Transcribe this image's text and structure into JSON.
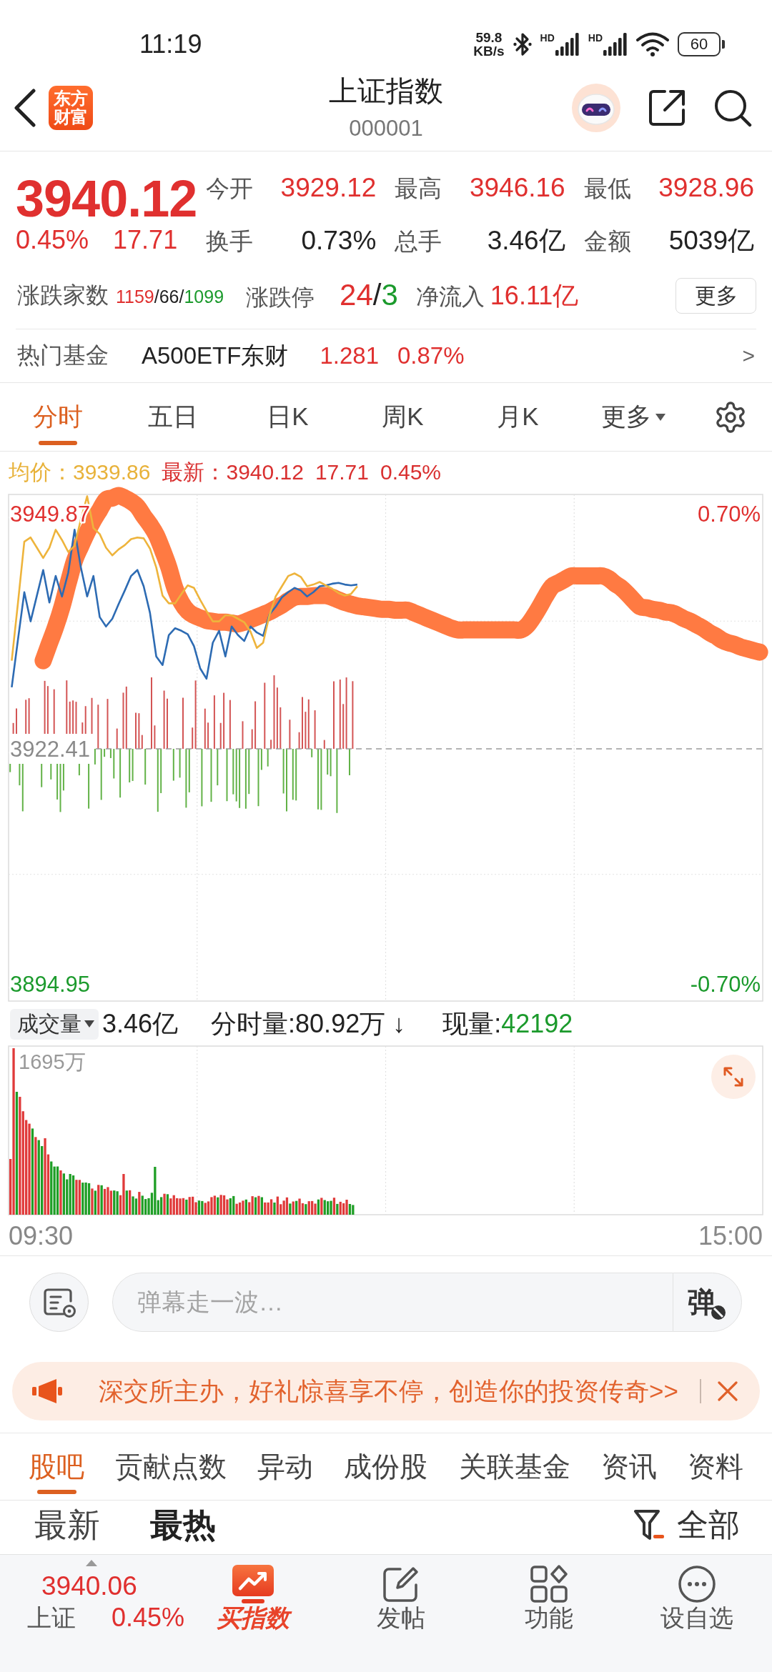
{
  "status_bar": {
    "time": "11:19",
    "net_speed": "59.8",
    "net_unit": "KB/s",
    "networks": [
      {
        "label": "HD"
      },
      {
        "label": "HD"
      }
    ],
    "battery": "60"
  },
  "header": {
    "logo": "东方财富",
    "title": "上证指数",
    "code": "000001"
  },
  "quote": {
    "price": "3940.12",
    "change_pct": "0.45%",
    "change": "17.71",
    "color": "#e0302f",
    "stats": [
      {
        "label": "今开",
        "value": "3929.12",
        "color": "#e0302f"
      },
      {
        "label": "最高",
        "value": "3946.16",
        "color": "#e0302f"
      },
      {
        "label": "最低",
        "value": "3928.96",
        "color": "#e0302f"
      },
      {
        "label": "换手",
        "value": "0.73%",
        "color": "#222222"
      },
      {
        "label": "总手",
        "value": "3.46亿",
        "color": "#222222"
      },
      {
        "label": "金额",
        "value": "5039亿",
        "color": "#222222"
      }
    ],
    "breadth": {
      "label": "涨跌家数",
      "parts": [
        {
          "text": "1159",
          "color": "#e0302f"
        },
        {
          "text": "/66/",
          "color": "#222222"
        },
        {
          "text": "1099",
          "color": "#1b9a2c"
        }
      ]
    },
    "limits": {
      "label": "涨跌停",
      "parts": [
        {
          "text": "24",
          "color": "#e0302f"
        },
        {
          "text": "/",
          "color": "#222222"
        },
        {
          "text": "3",
          "color": "#1b9a2c"
        }
      ]
    },
    "net_inflow": {
      "label": "净流入",
      "value": "16.11亿",
      "color": "#e0302f"
    },
    "more_button": "更多"
  },
  "hot_fund": {
    "label": "热门基金",
    "name": "A500ETF东财",
    "price": "1.281",
    "change": "0.87%",
    "color": "#e0302f",
    "arrow": ">"
  },
  "chart_tabs": [
    {
      "label": "分时",
      "selected": true,
      "kind": "tab"
    },
    {
      "label": "五日",
      "selected": false,
      "kind": "tab"
    },
    {
      "label": "日K",
      "selected": false,
      "kind": "tab"
    },
    {
      "label": "周K",
      "selected": false,
      "kind": "tab"
    },
    {
      "label": "月K",
      "selected": false,
      "kind": "tab"
    },
    {
      "label": "更多",
      "selected": false,
      "kind": "menu"
    }
  ],
  "legend": [
    {
      "text": "均价：3939.86",
      "color": "#e8b23a"
    },
    {
      "text": "最新：3940.12",
      "color": "#d93030"
    },
    {
      "text": "17.71",
      "color": "#d93030"
    },
    {
      "text": "0.45%",
      "color": "#d93030"
    }
  ],
  "price_chart": {
    "chart_data": {
      "type": "line",
      "categories": [
        null,
        null,
        null,
        null,
        null,
        null,
        null,
        null,
        null,
        null,
        null,
        null,
        null,
        null,
        null,
        null,
        null,
        null,
        null,
        null,
        null,
        null,
        null,
        null,
        null,
        null,
        null,
        null,
        null,
        null,
        null,
        null,
        null,
        null,
        null,
        null,
        null,
        null,
        null,
        null,
        null,
        null,
        null,
        null,
        null,
        null,
        null,
        null,
        null,
        null,
        null,
        null,
        null,
        null,
        null,
        null,
        null,
        null,
        null,
        null,
        null,
        null,
        null,
        null,
        null,
        null,
        null,
        null,
        null,
        null,
        null,
        null,
        null,
        null,
        null,
        null,
        null,
        null,
        null,
        null,
        null,
        null,
        null,
        null,
        null,
        null,
        null,
        null,
        null,
        null,
        null,
        null,
        null,
        null,
        null,
        null,
        null,
        null,
        null,
        null,
        null,
        null,
        null,
        null,
        null,
        null,
        null,
        null,
        null,
        null,
        null,
        null,
        null,
        null,
        null,
        null,
        null,
        null,
        null,
        null
      ],
      "ylim": [
        3892.95,
        3952.12
      ],
      "yticks": [
        {
          "value": 3949.87,
          "label": "3949.87"
        },
        {
          "value": 3922.41,
          "label": "3922.41"
        },
        {
          "value": 3894.95,
          "label": "3894.95"
        }
      ],
      "ref_lines": [
        {
          "axis": "y",
          "value": 3922.41
        }
      ],
      "series": [
        {
          "color": "#2d6bb3",
          "values": [
            3929.6,
            3935.2,
            3940.7,
            3937.3,
            3940.3,
            3943.3,
            3939.5,
            3942.6,
            3940.2,
            3943.0,
            3948.0,
            3943.6,
            3940.2,
            3942.6,
            3937.8,
            3936.7,
            3937.6,
            3939.3,
            3940.9,
            3942.6,
            3943.3,
            3941.4,
            3938.3,
            3933.2,
            3932.2,
            3935.7,
            3936.5,
            3936.2,
            3935.8,
            3934.4,
            3931.8,
            3930.6,
            3934.8,
            3936.2,
            3933.2,
            3936.7,
            3935.7,
            3935.0,
            3936.7,
            3936.0,
            3935.6,
            3938.1,
            3939.0,
            3940.1,
            3940.7,
            3941.2,
            3940.9,
            3940.2,
            3940.7,
            3941.4,
            3941.5,
            3941.7,
            3941.8,
            3941.6,
            3941.5,
            3941.6,
            null,
            null,
            null,
            null,
            null,
            null,
            null,
            null,
            null,
            null,
            null,
            null,
            null,
            null,
            null,
            null,
            null,
            null,
            null,
            null,
            null,
            null,
            null,
            null,
            null,
            null,
            null,
            null,
            null,
            null,
            null,
            null,
            null,
            null,
            null,
            null,
            null,
            null,
            null,
            null,
            null,
            null,
            null,
            null,
            null,
            null,
            null,
            null,
            null,
            null,
            null,
            null,
            null,
            null,
            null,
            null,
            null,
            null,
            null,
            null,
            null,
            null,
            null,
            null
          ]
        },
        {
          "color": "#eeb43c",
          "values": [
            3932.7,
            3939.5,
            3946.6,
            3947.1,
            3945.9,
            3944.7,
            3945.9,
            3948.0,
            3946.8,
            3945.4,
            3946.1,
            3949.2,
            3951.9,
            3948.2,
            3947.5,
            3945.9,
            3945.0,
            3945.7,
            3946.2,
            3946.9,
            3947.1,
            3947.0,
            3945.8,
            3943.6,
            3940.3,
            3939.4,
            3939.4,
            3940.5,
            3941.5,
            3941.2,
            3939.8,
            3938.5,
            3937.3,
            3937.3,
            3938.0,
            3938.0,
            3937.6,
            3937.2,
            3936.1,
            3934.2,
            3934.8,
            3938.0,
            3940.2,
            3941.4,
            3942.6,
            3942.9,
            3942.5,
            3941.4,
            3941.6,
            3941.9,
            3941.5,
            3941.1,
            3940.6,
            3940.3,
            3940.5,
            3941.4,
            null,
            null,
            null,
            null,
            null,
            null,
            null,
            null,
            null,
            null,
            null,
            null,
            null,
            null,
            null,
            null,
            null,
            null,
            null,
            null,
            null,
            null,
            null,
            null,
            null,
            null,
            null,
            null,
            null,
            null,
            null,
            null,
            null,
            null,
            null,
            null,
            null,
            null,
            null,
            null,
            null,
            null,
            null,
            null,
            null,
            null,
            null,
            null,
            null,
            null,
            null,
            null,
            null,
            null,
            null,
            null,
            null,
            null,
            null,
            null,
            null,
            null,
            null,
            null
          ]
        },
        {
          "color": "#ff7a42",
          "values": [
            null,
            null,
            null,
            null,
            null,
            3932.7,
            3934.7,
            3936.7,
            3939.0,
            3941.8,
            3944.4,
            3946.1,
            3947.7,
            3949.1,
            3950.3,
            3951.5,
            3951.7,
            3952.0,
            3951.7,
            3951.3,
            3950.7,
            3949.6,
            3948.6,
            3947.4,
            3945.6,
            3943.6,
            3941.1,
            3939.5,
            3938.5,
            3938.0,
            3937.7,
            3937.4,
            3937.3,
            3937.2,
            3937.2,
            3937.1,
            3937.0,
            3937.2,
            3937.5,
            3937.8,
            3938.1,
            3938.4,
            3938.8,
            3939.2,
            3939.7,
            3940.1,
            3940.2,
            3940.2,
            3940.3,
            3940.3,
            3940.3,
            3940.1,
            3939.8,
            3939.5,
            3939.3,
            3939.1,
            3939.0,
            3938.9,
            3938.8,
            3938.7,
            3938.7,
            3938.6,
            3938.6,
            3938.6,
            3938.3,
            3938.0,
            3937.7,
            3937.4,
            3937.1,
            3936.8,
            3936.5,
            3936.3,
            3936.3,
            3936.3,
            3936.3,
            3936.3,
            3936.3,
            3936.3,
            3936.3,
            3936.3,
            3936.3,
            3936.3,
            3936.8,
            3937.8,
            3939.0,
            3940.3,
            3941.4,
            3941.8,
            3942.2,
            3942.6,
            3942.6,
            3942.6,
            3942.6,
            3942.6,
            3942.6,
            3942.3,
            3941.7,
            3941.2,
            3940.5,
            3939.7,
            3939.0,
            3938.9,
            3938.7,
            3938.6,
            3938.4,
            3938.3,
            3938.0,
            3937.6,
            3937.3,
            3936.9,
            3936.5,
            3936.0,
            3935.6,
            3935.1,
            3934.8,
            3934.6,
            3934.3,
            3934.1,
            3933.9,
            3933.7
          ]
        }
      ]
    },
    "right_labels": [
      {
        "text": "0.70%",
        "color": "#e0302f"
      },
      {
        "text": "-0.70%",
        "color": "#1b9a2c"
      }
    ]
  },
  "volume": {
    "selector": "成交量",
    "total": "3.46亿",
    "per_minute": "分时量:80.92万 ↓",
    "current": {
      "label": "现量:",
      "value": "42192",
      "color": "#1b9a2c"
    },
    "max_label": "1695万",
    "time_axis": {
      "start": "09:30",
      "end": "15:00"
    }
  },
  "danmaku": {
    "placeholder": "弹幕走一波…",
    "send": "弹"
  },
  "banner": {
    "text": "深交所主办，好礼惊喜享不停，创造你的投资传奇>>"
  },
  "info_tabs": [
    {
      "label": "股吧",
      "selected": true
    },
    {
      "label": "贡献点数",
      "selected": false
    },
    {
      "label": "异动",
      "selected": false
    },
    {
      "label": "成份股",
      "selected": false
    },
    {
      "label": "关联基金",
      "selected": false
    },
    {
      "label": "资讯",
      "selected": false
    },
    {
      "label": "资料",
      "selected": false
    }
  ],
  "sort_tabs": [
    {
      "label": "最新",
      "selected": false
    },
    {
      "label": "最热",
      "selected": true
    }
  ],
  "filter": "全部",
  "bottom_nav": {
    "quote": {
      "price": "3940.06",
      "name": "上证",
      "change": "0.45%",
      "color": "#e0302f"
    },
    "items": [
      {
        "kind": "buy",
        "label": "买指数"
      },
      {
        "kind": "post",
        "label": "发帖"
      },
      {
        "kind": "tools",
        "label": "功能"
      },
      {
        "kind": "watch",
        "label": "设自选"
      }
    ]
  }
}
